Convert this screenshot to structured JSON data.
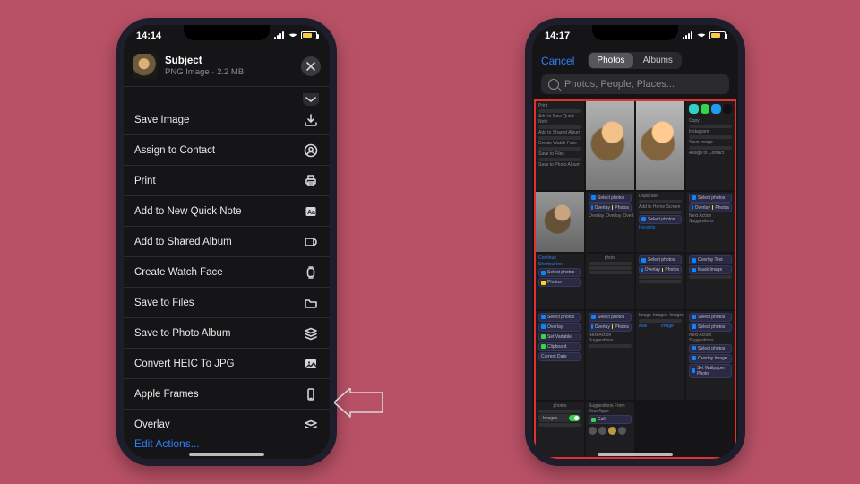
{
  "left": {
    "status_time": "14:14",
    "battery_text": "58",
    "sheet": {
      "title": "Subject",
      "subtitle": "PNG Image · 2.2 MB"
    },
    "actions": [
      {
        "label": "Save Image",
        "icon": "download-icon"
      },
      {
        "label": "Assign to Contact",
        "icon": "contact-icon"
      },
      {
        "label": "Print",
        "icon": "printer-icon"
      },
      {
        "label": "Add to New Quick Note",
        "icon": "quicknote-icon"
      },
      {
        "label": "Add to Shared Album",
        "icon": "shared-album-icon"
      },
      {
        "label": "Create Watch Face",
        "icon": "watch-icon"
      },
      {
        "label": "Save to Files",
        "icon": "folder-icon"
      },
      {
        "label": "Save to Photo Album",
        "icon": "stack-icon"
      },
      {
        "label": "Convert HEIC To JPG",
        "icon": "image-icon"
      },
      {
        "label": "Apple Frames",
        "icon": "phone-icon"
      },
      {
        "label": "Overlay",
        "icon": "overlay-icon"
      }
    ],
    "edit_actions": "Edit Actions..."
  },
  "right": {
    "status_time": "14:17",
    "cancel": "Cancel",
    "tabs": {
      "photos": "Photos",
      "albums": "Albums"
    },
    "search_placeholder": "Photos, People, Places...",
    "hints": {
      "print": "Print",
      "addnote": "Add to New Quick Note",
      "addshared": "Add to Shared Album",
      "watch": "Create Watch Face",
      "files": "Save to Files",
      "album": "Save to Photo Album",
      "copy": "Copy",
      "instagram": "Instagram",
      "saveimg": "Save Image",
      "assign": "Assign to Contact",
      "dup": "Duplicate",
      "homescreen": "Add to Home Screen",
      "recents": "Recents",
      "selectphotos": "Select photos",
      "overlay": "Overlay",
      "overlaytext": "Overlay Text",
      "maskimage": "Mask Image",
      "photoslbl": "Photos",
      "shortcut": "Shortcut text",
      "continue": "Continue",
      "nextactions": "Next Action Suggestions",
      "setvar": "Set Variable",
      "clipboard": "Clipboard",
      "date": "Current Date",
      "setwall": "Set Wallpaper Photo",
      "overlayimg": "Overlay Image",
      "images": "Images",
      "image": "Image",
      "imagery": "Imagery",
      "photobw": "photos",
      "mail": "Mail",
      "photo": "photo",
      "suggestions": "Suggestions From Your Apps",
      "call": "Call"
    }
  }
}
